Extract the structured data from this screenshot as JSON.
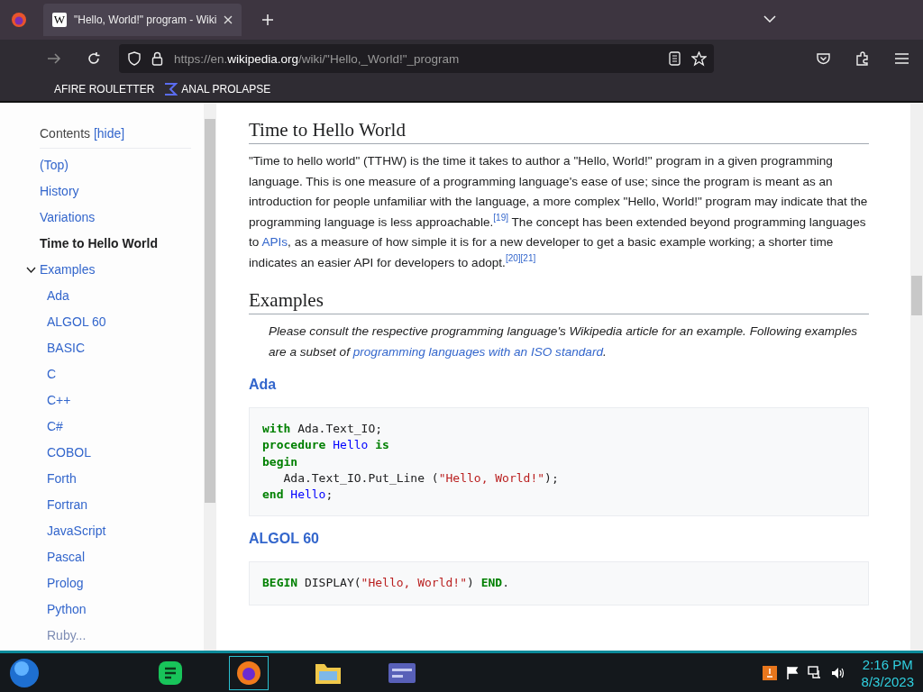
{
  "browser": {
    "tab": {
      "logo": "W",
      "title": "\"Hello, World!\" program - Wiki",
      "selected": true
    },
    "url": {
      "prefix": "https://en.",
      "domain": "wikipedia.org",
      "path": "/wiki/\"Hello,_World!\"_program"
    },
    "bookmarks": [
      {
        "label": "AFIRE ROULETTER"
      },
      {
        "label": "ANAL PROLAPSE"
      }
    ]
  },
  "toc": {
    "title": "Contents",
    "toggle": "[hide]",
    "items": [
      {
        "label": "(Top)",
        "selected": false
      },
      {
        "label": "History",
        "selected": false
      },
      {
        "label": "Variations",
        "selected": false
      },
      {
        "label": "Time to Hello World",
        "selected": true
      },
      {
        "label": "Examples",
        "selected": false,
        "expanded": true,
        "children": [
          {
            "label": "Ada",
            "selected": false
          },
          {
            "label": "ALGOL 60",
            "selected": false
          },
          {
            "label": "BASIC",
            "selected": false
          },
          {
            "label": "C",
            "selected": false
          },
          {
            "label": "C++",
            "selected": false
          },
          {
            "label": "C#",
            "selected": false
          },
          {
            "label": "COBOL",
            "selected": false
          },
          {
            "label": "Forth",
            "selected": false
          },
          {
            "label": "Fortran",
            "selected": false
          },
          {
            "label": "JavaScript",
            "selected": false
          },
          {
            "label": "Pascal",
            "selected": false
          },
          {
            "label": "Prolog",
            "selected": false
          },
          {
            "label": "Python",
            "selected": false
          },
          {
            "label": "Ruby...",
            "selected": false
          }
        ]
      }
    ]
  },
  "article": [
    {
      "kind": "heading",
      "text": "Time to Hello World"
    },
    {
      "kind": "paragraph",
      "segments": [
        {
          "kind": "text",
          "text": "\"Time to hello world\" (TTHW) is the time it takes to author a \"Hello, World!\" program in a given programming language. This is one measure of a programming language's ease of use; since the program is meant as an introduction for people unfamiliar with the language, a more complex \"Hello, World!\" program may indicate that the programming language is less approachable."
        },
        {
          "kind": "ref",
          "text": "[19]"
        },
        {
          "kind": "text",
          "text": " The concept has been extended beyond programming languages to "
        },
        {
          "kind": "link",
          "text": "APIs"
        },
        {
          "kind": "text",
          "text": ", as a measure of how simple it is for a new developer to get a basic example working; a shorter time indicates an easier API for developers to adopt."
        },
        {
          "kind": "ref",
          "text": "[20]"
        },
        {
          "kind": "ref",
          "text": "[21]"
        }
      ]
    },
    {
      "kind": "heading",
      "text": "Examples"
    },
    {
      "kind": "note",
      "segments": [
        {
          "kind": "text",
          "text": "Please consult the respective programming language's Wikipedia article for an example. Following examples are a subset of "
        },
        {
          "kind": "link",
          "text": "programming languages with an ISO standard"
        },
        {
          "kind": "text",
          "text": "."
        }
      ]
    },
    {
      "kind": "subheading",
      "text": "Ada"
    },
    {
      "kind": "code",
      "lines": [
        [
          {
            "kind": "keyword",
            "text": "with"
          },
          {
            "kind": "plain",
            "text": " Ada.Text_IO;"
          }
        ],
        [
          {
            "kind": "keyword",
            "text": "procedure"
          },
          {
            "kind": "name",
            "text": " Hello"
          },
          {
            "kind": "keyword",
            "text": " is"
          }
        ],
        [
          {
            "kind": "keyword",
            "text": "begin"
          }
        ],
        [
          {
            "kind": "plain",
            "text": "   Ada.Text_IO.Put_Line ("
          },
          {
            "kind": "string",
            "text": "\"Hello, World!\""
          },
          {
            "kind": "plain",
            "text": ");"
          }
        ],
        [
          {
            "kind": "keyword",
            "text": "end"
          },
          {
            "kind": "name",
            "text": " Hello"
          },
          {
            "kind": "plain",
            "text": ";"
          }
        ]
      ]
    },
    {
      "kind": "subheading",
      "text": "ALGOL 60"
    },
    {
      "kind": "code",
      "lines": [
        [
          {
            "kind": "keyword",
            "text": "BEGIN"
          },
          {
            "kind": "plain",
            "text": " DISPLAY("
          },
          {
            "kind": "string",
            "text": "\"Hello, World!\""
          },
          {
            "kind": "plain",
            "text": ") "
          },
          {
            "kind": "keyword",
            "text": "END"
          },
          {
            "kind": "plain",
            "text": "."
          }
        ]
      ]
    }
  ],
  "taskbar": {
    "time": "2:16 PM",
    "date": "8/3/2023"
  }
}
